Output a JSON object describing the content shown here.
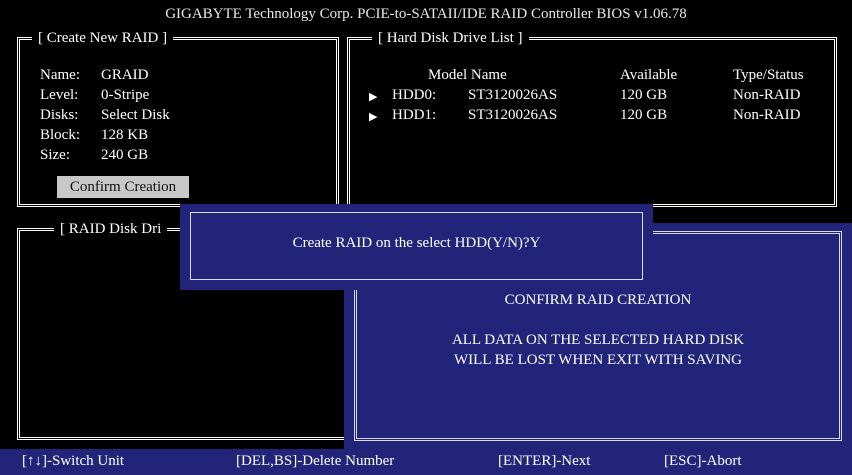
{
  "title": "GIGABYTE Technology Corp. PCIE-to-SATAII/IDE RAID Controller BIOS v1.06.78",
  "create_raid": {
    "heading": "[ Create New RAID ]",
    "fields": [
      {
        "label": "Name:",
        "value": "GRAID"
      },
      {
        "label": "Level:",
        "value": "0-Stripe"
      },
      {
        "label": "Disks:",
        "value": "Select Disk"
      },
      {
        "label": "Block:",
        "value": "128 KB"
      },
      {
        "label": "Size:",
        "value": "240 GB"
      }
    ],
    "confirm_button": "Confirm Creation"
  },
  "hdd_list": {
    "heading": "[ Hard Disk Drive List ]",
    "columns": [
      "Model Name",
      "Available",
      "Type/Status"
    ],
    "rows": [
      {
        "id": "HDD0:",
        "model": "ST3120026AS",
        "available": "120 GB",
        "status": "Non-RAID"
      },
      {
        "id": "HDD1:",
        "model": "ST3120026AS",
        "available": "120 GB",
        "status": "Non-RAID"
      }
    ]
  },
  "raid_disk": {
    "heading": "[ RAID Disk Dri"
  },
  "dialog": {
    "prompt": "Create RAID on the select HDD(Y/N)?Y"
  },
  "warning": {
    "title": "CONFIRM RAID CREATION",
    "line1": "ALL DATA ON THE SELECTED HARD DISK",
    "line2": "WILL BE LOST WHEN EXIT WITH SAVING"
  },
  "footer": {
    "switch": "[↑↓]-Switch Unit",
    "delete": "[DEL,BS]-Delete Number",
    "next": "[ENTER]-Next",
    "abort": "[ESC]-Abort"
  },
  "colors": {
    "background": "#000000",
    "dialog_blue": "#22247a",
    "button_gray": "#c8c8c8"
  }
}
